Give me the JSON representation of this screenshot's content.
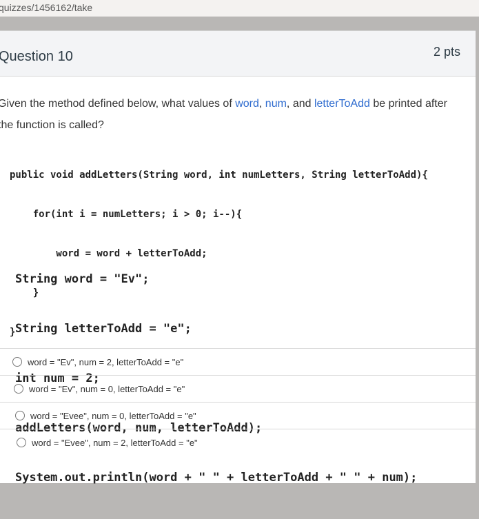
{
  "browser": {
    "url": "quizzes/1456162/take"
  },
  "question": {
    "title": "Question 10",
    "points": "2 pts",
    "prompt": {
      "p1": "Given the method defined below, what values of ",
      "word": "word",
      "sep1": ", ",
      "num": "num",
      "sep2": ", and ",
      "letter": "letterToAdd",
      "p2": " be printed after the function is called?"
    },
    "code_method": [
      "public void addLetters(String word, int numLetters, String letterToAdd){",
      "    for(int i = numLetters; i > 0; i--){",
      "        word = word + letterToAdd;",
      "    }",
      "}"
    ],
    "code_main": [
      "String word = \"Ev\";",
      "String letterToAdd = \"e\";",
      "int num = 2;",
      "addLetters(word, num, letterToAdd);",
      "System.out.println(word + \" \" + letterToAdd + \" \" + num);"
    ]
  },
  "answers": [
    {
      "label": "word = \"Ev\", num = 2, letterToAdd = \"e\""
    },
    {
      "label": "word = \"Ev\", num = 0, letterToAdd = \"e\""
    },
    {
      "label": "word = \"Evee\", num = 0, letterToAdd = \"e\""
    },
    {
      "label": "word = \"Evee\", num = 2, letterToAdd = \"e\""
    }
  ],
  "colors": {
    "accent_blue": "#2f6ccf",
    "keyword_purple": "#7b2fa3",
    "header_bg": "#f3f4f6"
  }
}
